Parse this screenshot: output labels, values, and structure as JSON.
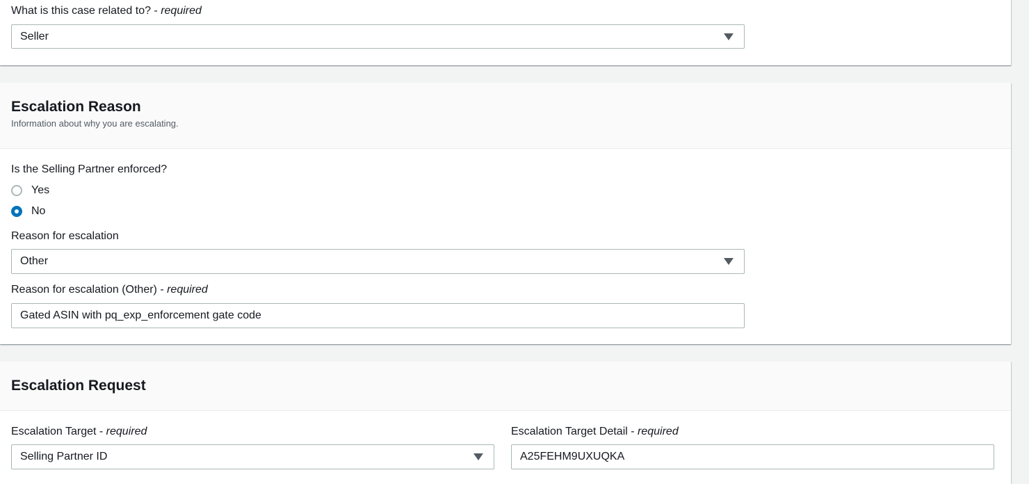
{
  "section_case": {
    "related_label": "What is this case related to?",
    "related_sep": " - ",
    "related_required": "required",
    "related_value": "Seller"
  },
  "section_reason": {
    "title": "Escalation Reason",
    "description": "Information about why you are escalating.",
    "enforced_question": "Is the Selling Partner enforced?",
    "options": [
      "Yes",
      "No"
    ],
    "selected_option": "No",
    "reason_label": "Reason for escalation",
    "reason_value": "Other",
    "other_label": "Reason for escalation (Other)",
    "other_sep": " - ",
    "other_required": "required",
    "other_value": "Gated ASIN with pq_exp_enforcement gate code"
  },
  "section_request": {
    "title": "Escalation Request",
    "target_label": "Escalation Target",
    "target_sep": " - ",
    "target_required": "required",
    "target_value": "Selling Partner ID",
    "detail_label": "Escalation Target Detail",
    "detail_sep": " - ",
    "detail_required": "required",
    "detail_value": "A25FEHM9UXUQKA"
  },
  "colors": {
    "accent": "#0073bb",
    "border": "#aab7b8",
    "page_bg": "#f2f3f3"
  }
}
